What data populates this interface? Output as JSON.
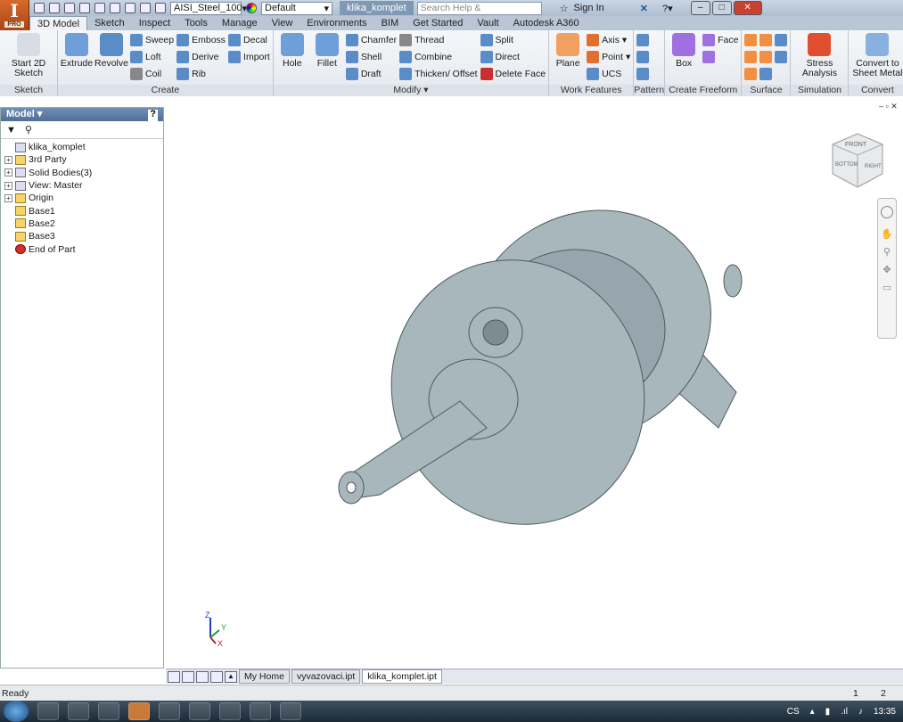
{
  "app": {
    "logo_text": "I",
    "edition": "PRO",
    "document_title": "klika_komplet"
  },
  "quick_access": {
    "material": "AISI_Steel_100",
    "appearance": "Default",
    "search_placeholder": "Search Help & Commands...",
    "sign_in": "Sign In"
  },
  "tabs": [
    "3D Model",
    "Sketch",
    "Inspect",
    "Tools",
    "Manage",
    "View",
    "Environments",
    "BIM",
    "Get Started",
    "Vault",
    "Autodesk A360"
  ],
  "active_tab": "3D Model",
  "ribbon": [
    {
      "label": "Sketch",
      "big": [
        {
          "label": "Start 2D Sketch",
          "icon": "sketch-icon",
          "color": "#d8dce4"
        }
      ],
      "cols": []
    },
    {
      "label": "Create",
      "big": [
        {
          "label": "Extrude",
          "icon": "extrude-icon",
          "color": "#6f9fd8"
        },
        {
          "label": "Revolve",
          "icon": "revolve-icon",
          "color": "#5a8cc8"
        }
      ],
      "cols": [
        [
          {
            "label": "Sweep",
            "icon": "sweep-icon",
            "color": "#5a8cc8"
          },
          {
            "label": "Loft",
            "icon": "loft-icon",
            "color": "#5a8cc8"
          },
          {
            "label": "Coil",
            "icon": "coil-icon",
            "color": "#888"
          }
        ],
        [
          {
            "label": "Emboss",
            "icon": "emboss-icon",
            "color": "#5a8cc8"
          },
          {
            "label": "Derive",
            "icon": "derive-icon",
            "color": "#5a8cc8"
          },
          {
            "label": "Rib",
            "icon": "rib-icon",
            "color": "#5a8cc8"
          }
        ],
        [
          {
            "label": "Decal",
            "icon": "decal-icon",
            "color": "#5a8cc8"
          },
          {
            "label": "Import",
            "icon": "import-icon",
            "color": "#5a8cc8"
          }
        ]
      ]
    },
    {
      "label": "Modify ▾",
      "big": [
        {
          "label": "Hole",
          "icon": "hole-icon",
          "color": "#6f9fd8"
        },
        {
          "label": "Fillet",
          "icon": "fillet-icon",
          "color": "#6f9fd8"
        }
      ],
      "cols": [
        [
          {
            "label": "Chamfer",
            "icon": "chamfer-icon",
            "color": "#5a8cc8"
          },
          {
            "label": "Shell",
            "icon": "shell-icon",
            "color": "#5a8cc8"
          },
          {
            "label": "Draft",
            "icon": "draft-icon",
            "color": "#5a8cc8"
          }
        ],
        [
          {
            "label": "Thread",
            "icon": "thread-icon",
            "color": "#888"
          },
          {
            "label": "Combine",
            "icon": "combine-icon",
            "color": "#5a8cc8"
          },
          {
            "label": "Thicken/ Offset",
            "icon": "thicken-icon",
            "color": "#5a8cc8"
          }
        ],
        [
          {
            "label": "Split",
            "icon": "split-icon",
            "color": "#5a8cc8"
          },
          {
            "label": "Direct",
            "icon": "direct-icon",
            "color": "#5a8cc8"
          },
          {
            "label": "Delete Face",
            "icon": "delete-face-icon",
            "color": "#c83030"
          }
        ]
      ]
    },
    {
      "label": "Work Features",
      "big": [
        {
          "label": "Plane",
          "icon": "plane-icon",
          "color": "#f0a060"
        }
      ],
      "cols": [
        [
          {
            "label": "Axis ▾",
            "icon": "axis-icon",
            "color": "#e07030"
          },
          {
            "label": "Point ▾",
            "icon": "point-icon",
            "color": "#e07030"
          },
          {
            "label": "UCS",
            "icon": "ucs-icon",
            "color": "#5a8cc8"
          }
        ]
      ]
    },
    {
      "label": "Pattern",
      "big": [],
      "cols": [
        [
          {
            "label": "",
            "icon": "rectangular-pattern-icon",
            "color": "#5a8cc8"
          },
          {
            "label": "",
            "icon": "circular-pattern-icon",
            "color": "#5a8cc8"
          },
          {
            "label": "",
            "icon": "mirror-icon",
            "color": "#5a8cc8"
          }
        ]
      ]
    },
    {
      "label": "Create Freeform",
      "big": [
        {
          "label": "Box",
          "icon": "box-icon",
          "color": "#a070e0"
        }
      ],
      "cols": [
        [
          {
            "label": "Face",
            "icon": "face-icon",
            "color": "#a070e0"
          },
          {
            "label": "",
            "icon": "freeform-convert-icon",
            "color": "#a070e0"
          }
        ]
      ]
    },
    {
      "label": "Surface",
      "big": [],
      "cols": [
        [
          {
            "label": "",
            "icon": "stitch-icon",
            "color": "#f09040"
          },
          {
            "label": "",
            "icon": "patch-icon",
            "color": "#f09040"
          },
          {
            "label": "",
            "icon": "ruled-surface-icon",
            "color": "#f09040"
          }
        ],
        [
          {
            "label": "",
            "icon": "sculpt-icon",
            "color": "#f09040"
          },
          {
            "label": "",
            "icon": "trim-icon",
            "color": "#f09040"
          },
          {
            "label": "",
            "icon": "extend-icon",
            "color": "#5a8cc8"
          }
        ],
        [
          {
            "label": "",
            "icon": "replace-face-icon",
            "color": "#5a8cc8"
          },
          {
            "label": "",
            "icon": "repair-icon",
            "color": "#5a8cc8"
          }
        ]
      ]
    },
    {
      "label": "Simulation",
      "big": [
        {
          "label": "Stress Analysis",
          "icon": "stress-analysis-icon",
          "color": "#e05030"
        }
      ],
      "cols": []
    },
    {
      "label": "Convert",
      "big": [
        {
          "label": "Convert to Sheet Metal",
          "icon": "sheet-metal-icon",
          "color": "#8ab0e0"
        }
      ],
      "cols": []
    }
  ],
  "browser": {
    "title": "Model ▾",
    "help": "?",
    "tree": [
      {
        "label": "klika_komplet",
        "icon": "part-icon",
        "expander": ""
      },
      {
        "label": "3rd Party",
        "icon": "folder-icon",
        "expander": "+"
      },
      {
        "label": "Solid Bodies(3)",
        "icon": "solid-bodies-icon",
        "expander": "+"
      },
      {
        "label": "View: Master",
        "icon": "view-icon",
        "expander": "+"
      },
      {
        "label": "Origin",
        "icon": "folder-icon",
        "expander": "+"
      },
      {
        "label": "Base1",
        "icon": "base-feature-icon",
        "expander": ""
      },
      {
        "label": "Base2",
        "icon": "base-feature-icon",
        "expander": ""
      },
      {
        "label": "Base3",
        "icon": "base-feature-icon",
        "expander": ""
      },
      {
        "label": "End of Part",
        "icon": "end-of-part-icon",
        "expander": ""
      }
    ]
  },
  "viewcube": {
    "front": "FRONT",
    "right": "RIGHT",
    "bottom": "BOTTOM"
  },
  "triad": {
    "x": "X",
    "y": "Y",
    "z": "Z"
  },
  "doc_tabs": [
    "My Home",
    "vyvazovaci.ipt",
    "klika_komplet.ipt"
  ],
  "active_doc": "klika_komplet.ipt",
  "status": {
    "text": "Ready",
    "num1": "1",
    "num2": "2"
  },
  "taskbar": {
    "lang": "CS",
    "time": "13:35"
  },
  "colors": {
    "model": "#a8b7bc",
    "accent": "#4f6f96"
  }
}
